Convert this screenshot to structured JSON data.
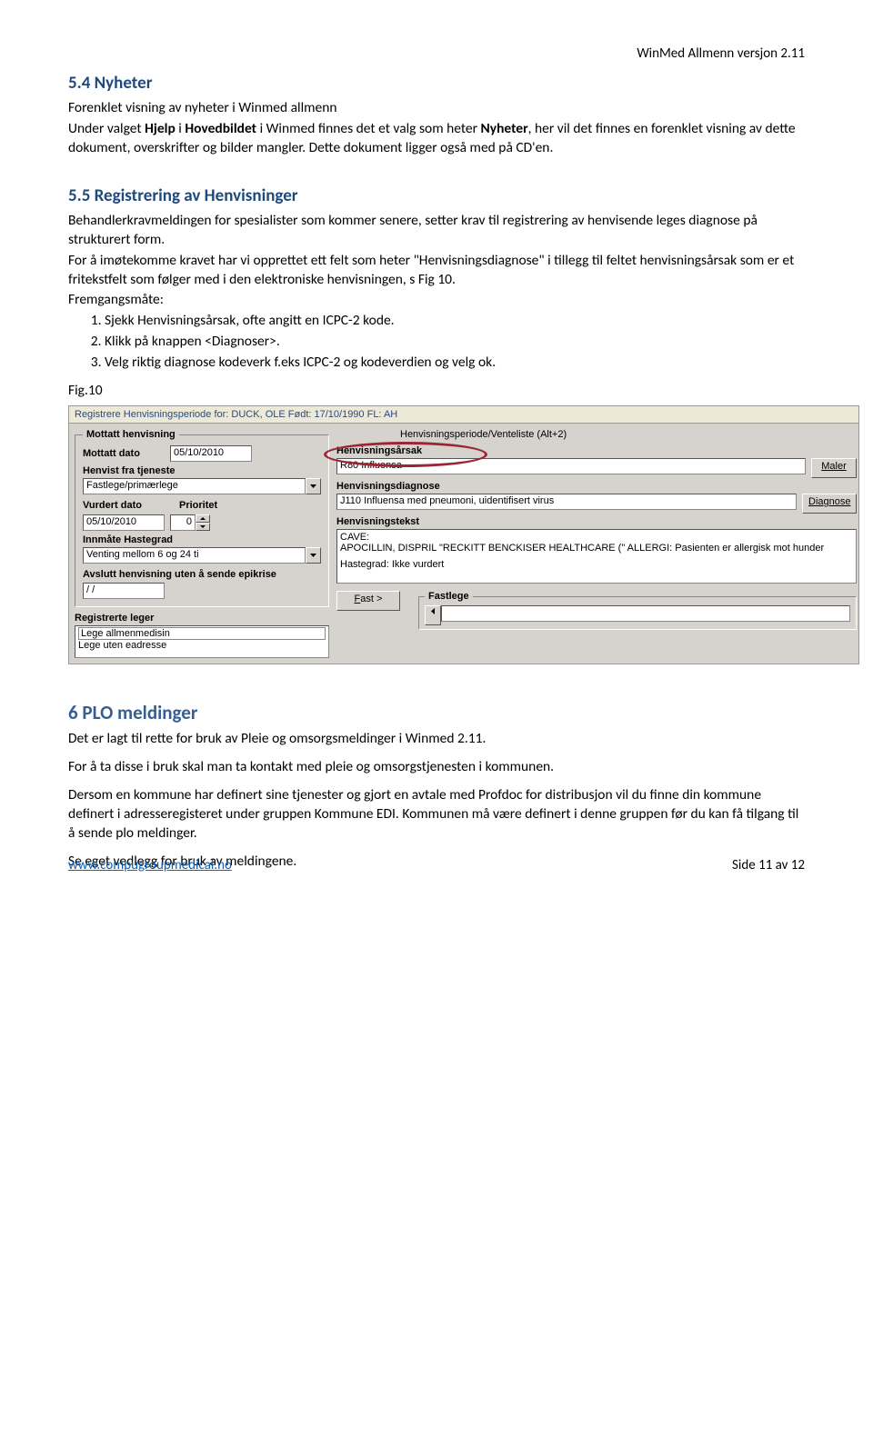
{
  "header": {
    "right": "WinMed Allmenn versjon 2.11"
  },
  "s54": {
    "heading": "5.4 Nyheter",
    "p1a": "Forenklet visning av nyheter i Winmed allmenn",
    "p2a": "Under valget ",
    "p2b": "Hjelp",
    "p2c": " i ",
    "p2d": "Hovedbildet",
    "p2e": " i Winmed finnes det et valg som heter ",
    "p2f": "Nyheter",
    "p2g": ", her vil det finnes en forenklet visning av dette dokument, overskrifter og bilder mangler. Dette dokument ligger også med på CD'en."
  },
  "s55": {
    "heading": "5.5 Registrering av Henvisninger",
    "p1": "Behandlerkravmeldingen for spesialister som kommer senere, setter krav til registrering av henvisende leges diagnose på strukturert form.",
    "p2": "For å imøtekomme kravet har vi opprettet ett felt som heter \"Henvisningsdiagnose\" i tillegg til feltet henvisningsårsak som er et fritekstfelt som følger med i den elektroniske henvisningen, s Fig 10.",
    "p3": "Fremgangsmåte:",
    "steps": [
      "Sjekk Henvisningsårsak, ofte angitt en ICPC-2 kode.",
      "Klikk på knappen <Diagnoser>.",
      "Velg riktig diagnose kodeverk f.eks ICPC-2 og kodeverdien og velg ok."
    ],
    "figlabel": "Fig.10"
  },
  "ss": {
    "title": "Registrere Henvisningsperiode for: DUCK, OLE Født: 17/10/1990 FL: AH",
    "left": {
      "legend": "Mottatt henvisning",
      "mottatt_lbl": "Mottatt dato",
      "mottatt_val": "05/10/2010",
      "henvist_lbl": "Henvist fra tjeneste",
      "henvist_val": "Fastlege/primærlege",
      "vurdert_lbl": "Vurdert dato",
      "vurdert_val": "05/10/2010",
      "prior_lbl": "Prioritet",
      "prior_val": "0",
      "innmate_lbl": "Innmåte Hastegrad",
      "innmate_val": "Venting mellom 6 og 24 ti",
      "avslutt_lbl": "Avslutt henvisning uten å sende epikrise",
      "avslutt_val": " / /",
      "regleger_lbl": "Registrerte leger",
      "lege1": "Lege allmenmedisin",
      "lege2": "Lege uten eadresse"
    },
    "right": {
      "tab": "Henvisningsperiode/Venteliste (Alt+2)",
      "arsak_lbl": "Henvisningsårsak",
      "arsak_val": "R80 Influensa",
      "diag_lbl": "Henvisningsdiagnose",
      "diag_val": "J110 Influensa med pneumoni, uidentifisert virus",
      "tekst_lbl": "Henvisningstekst",
      "cave": "CAVE:",
      "care_text": "APOCILLIN, DISPRIL \"RECKITT BENCKISER HEALTHCARE (\" ALLERGI: Pasienten er allergisk mot hunder",
      "hastegrad": "Hastegrad: Ikke vurdert",
      "fast_btn": "Fast >",
      "fastlege_legend": "Fastlege",
      "maler_btn": "Maler",
      "diagnose_btn": "Diagnose"
    }
  },
  "s6": {
    "heading": "6 PLO meldinger",
    "p1": "Det er lagt til rette for bruk av Pleie og omsorgsmeldinger i Winmed 2.11.",
    "p2": "For å ta disse i bruk skal man ta kontakt med pleie og omsorgstjenesten i kommunen.",
    "p3": "Dersom en kommune har definert sine tjenester og gjort en avtale med Profdoc for distribusjon vil du finne din kommune definert i adresseregisteret under gruppen Kommune EDI. Kommunen må være definert i denne gruppen før du kan få tilgang til å sende plo meldinger.",
    "p4": "Se eget vedlegg for bruk av meldingene."
  },
  "footer": {
    "url": "www.compugroupmedical.no",
    "page": "Side 11 av 12"
  }
}
